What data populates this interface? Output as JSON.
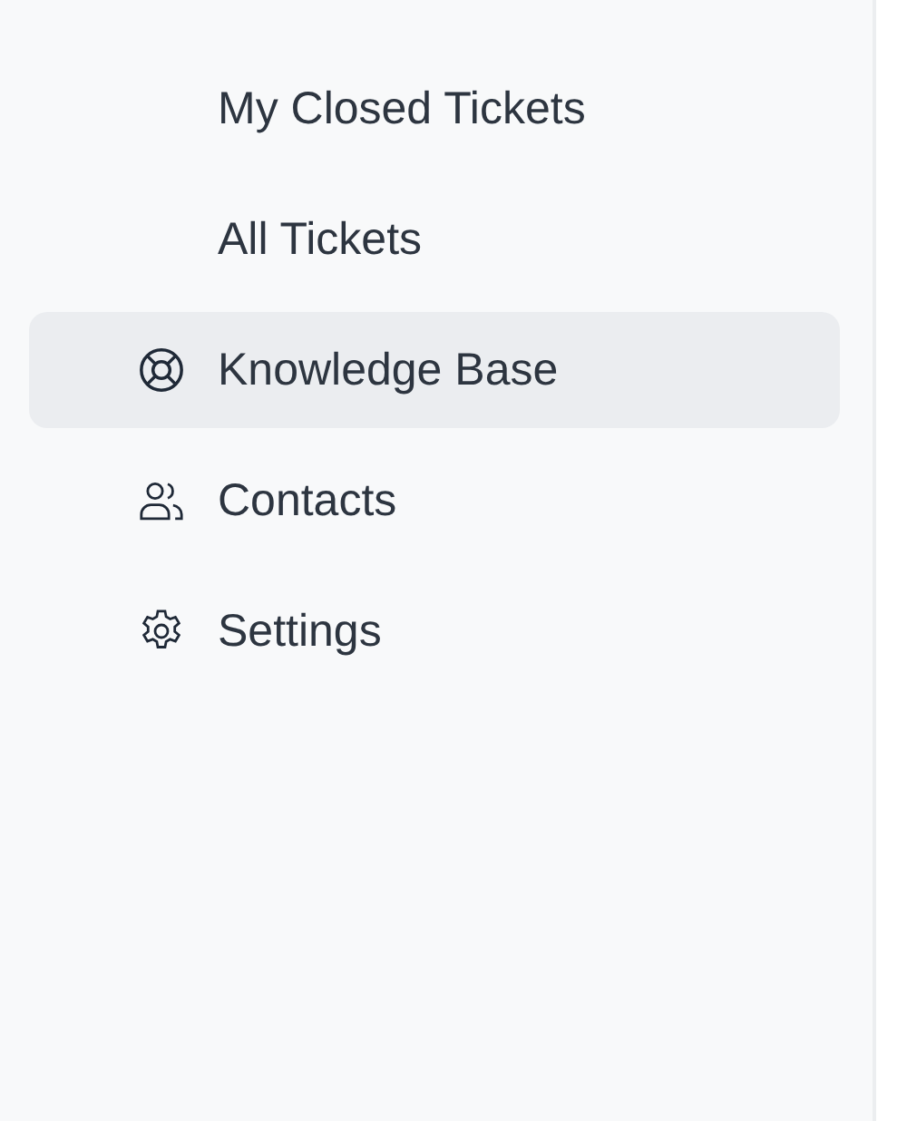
{
  "sidebar": {
    "items": [
      {
        "label": "My Closed Tickets",
        "kind": "subitem",
        "selected": false
      },
      {
        "label": "All Tickets",
        "kind": "subitem",
        "selected": false
      },
      {
        "label": "Knowledge Base",
        "kind": "item",
        "selected": true
      },
      {
        "label": "Contacts",
        "kind": "item",
        "selected": false
      },
      {
        "label": "Settings",
        "kind": "item",
        "selected": false
      }
    ]
  }
}
